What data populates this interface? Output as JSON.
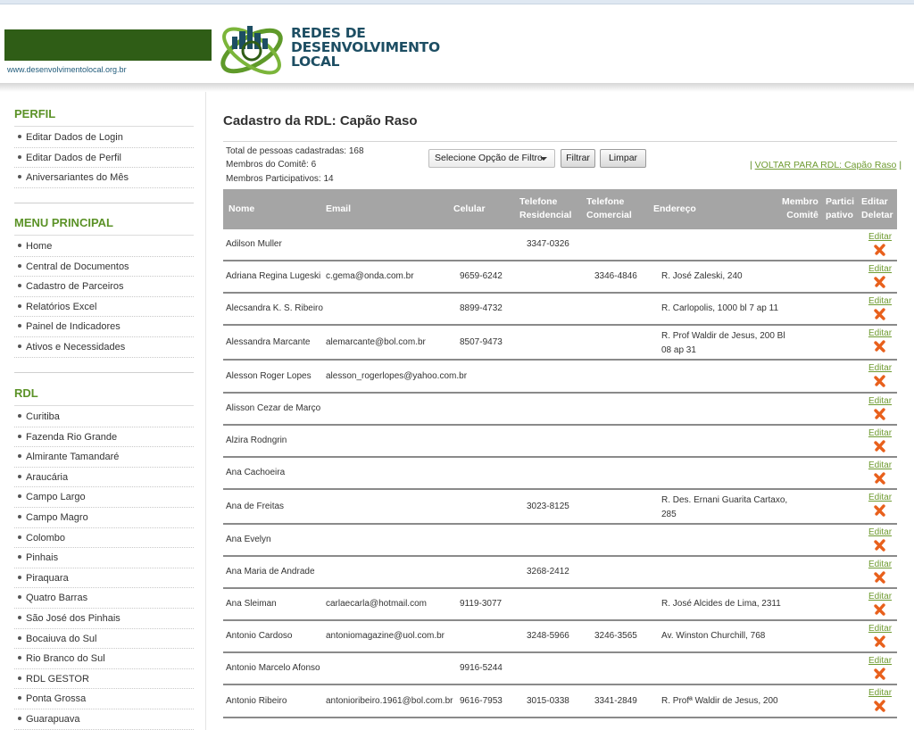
{
  "header": {
    "site_url": "www.desenvolvimentolocal.org.br",
    "logo_line1": "REDES DE",
    "logo_line2": "DESENVOLVIMENTO",
    "logo_line3": "LOCAL"
  },
  "sidebar": {
    "perfil_title": "PERFIL",
    "perfil_items": [
      "Editar Dados de Login",
      "Editar Dados de Perfil",
      "Aniversariantes do Mês"
    ],
    "menu_title": "MENU PRINCIPAL",
    "menu_items": [
      "Home",
      "Central de Documentos",
      "Cadastro de Parceiros",
      "Relatórios Excel",
      "Painel de Indicadores",
      "Ativos e Necessidades"
    ],
    "rdl_title": "RDL",
    "rdl_items": [
      "Curitiba",
      "Fazenda Rio Grande",
      "Almirante Tamandaré",
      "Araucária",
      "Campo Largo",
      "Campo Magro",
      "Colombo",
      "Pinhais",
      "Piraquara",
      "Quatro Barras",
      "São José dos Pinhais",
      "Bocaiuva do Sul",
      "Rio Branco do Sul",
      "RDL GESTOR",
      "Ponta Grossa",
      "Guarapuava"
    ]
  },
  "main": {
    "title": "Cadastro da RDL: Capão Raso",
    "total": "Total de pessoas cadastradas: 168",
    "comite": "Membros do Comitê: 6",
    "participativos": "Membros Participativos: 14",
    "filter_select": "Selecione Opção de Filtro",
    "filter_button": "Filtrar",
    "clear_button": "Limpar",
    "back_sep_left": "|",
    "back_link": "VOLTAR PARA RDL: Capão Raso",
    "back_sep_right": "|"
  },
  "table": {
    "headers": {
      "nome": "Nome",
      "email": "Email",
      "celular": "Celular",
      "tel_res_1": "Telefone",
      "tel_res_2": "Residencial",
      "tel_com_1": "Telefone",
      "tel_com_2": "Comercial",
      "endereco": "Endereço",
      "membro_1": "Membro",
      "membro_2": "Comitê",
      "partic_1": "Partici",
      "partic_2": "pativo",
      "editar_1": "Editar",
      "editar_2": "Deletar"
    },
    "edit_label": "Editar",
    "rows": [
      {
        "nome": "Adilson Muller",
        "email": "",
        "celular": "",
        "tel_res": "3347-0326",
        "tel_com": "",
        "endereco": ""
      },
      {
        "nome": "Adriana Regina Lugeski",
        "email": "c.gema@onda.com.br",
        "celular": "9659-6242",
        "tel_res": "",
        "tel_com": "3346-4846",
        "endereco": "R. José Zaleski, 240"
      },
      {
        "nome": "Alecsandra K. S. Ribeiro",
        "email": "",
        "celular": "8899-4732",
        "tel_res": "",
        "tel_com": "",
        "endereco": "R. Carlopolis, 1000 bl 7 ap 11"
      },
      {
        "nome": "Alessandra Marcante",
        "email": "alemarcante@bol.com.br",
        "celular": "8507-9473",
        "tel_res": "",
        "tel_com": "",
        "endereco": "R. Prof Waldir de Jesus, 200 Bl 08 ap 31"
      },
      {
        "nome": "Alesson Roger Lopes",
        "email": "alesson_rogerlopes@yahoo.com.br",
        "celular": "",
        "tel_res": "",
        "tel_com": "",
        "endereco": ""
      },
      {
        "nome": "Alisson Cezar de Março",
        "email": "",
        "celular": "",
        "tel_res": "",
        "tel_com": "",
        "endereco": ""
      },
      {
        "nome": "Alzira Rodngrin",
        "email": "",
        "celular": "",
        "tel_res": "",
        "tel_com": "",
        "endereco": ""
      },
      {
        "nome": "Ana Cachoeira",
        "email": "",
        "celular": "",
        "tel_res": "",
        "tel_com": "",
        "endereco": ""
      },
      {
        "nome": "Ana de Freitas",
        "email": "",
        "celular": "",
        "tel_res": "3023-8125",
        "tel_com": "",
        "endereco": "R. Des. Ernani Guarita Cartaxo, 285"
      },
      {
        "nome": "Ana Evelyn",
        "email": "",
        "celular": "",
        "tel_res": "",
        "tel_com": "",
        "endereco": ""
      },
      {
        "nome": "Ana Maria de Andrade",
        "email": "",
        "celular": "",
        "tel_res": "3268-2412",
        "tel_com": "",
        "endereco": ""
      },
      {
        "nome": "Ana Sleiman",
        "email": "carlaecarla@hotmail.com",
        "celular": "9119-3077",
        "tel_res": "",
        "tel_com": "",
        "endereco": "R. José Alcides de Lima, 2311"
      },
      {
        "nome": "Antonio Cardoso",
        "email": "antoniomagazine@uol.com.br",
        "celular": "",
        "tel_res": "3248-5966",
        "tel_com": "3246-3565",
        "endereco": "Av. Winston Churchill, 768"
      },
      {
        "nome": "Antonio Marcelo Afonso",
        "email": "",
        "celular": "9916-5244",
        "tel_res": "",
        "tel_com": "",
        "endereco": ""
      },
      {
        "nome": "Antonio Ribeiro",
        "email": "antonioribeiro.1961@bol.com.br",
        "celular": "9616-7953",
        "tel_res": "3015-0338",
        "tel_com": "3341-2849",
        "endereco": "R. Profª Waldir de Jesus, 200"
      }
    ]
  },
  "colors": {
    "brand_green": "#2f5d16",
    "link_green": "#6f9b31",
    "section_green": "#5b9227",
    "header_gray": "#a5a5a5",
    "delete_orange": "#e8601c"
  },
  "icons": {
    "delete": "delete-x-icon",
    "dropdown": "caret-down-icon",
    "logo": "globe-city-logo"
  }
}
